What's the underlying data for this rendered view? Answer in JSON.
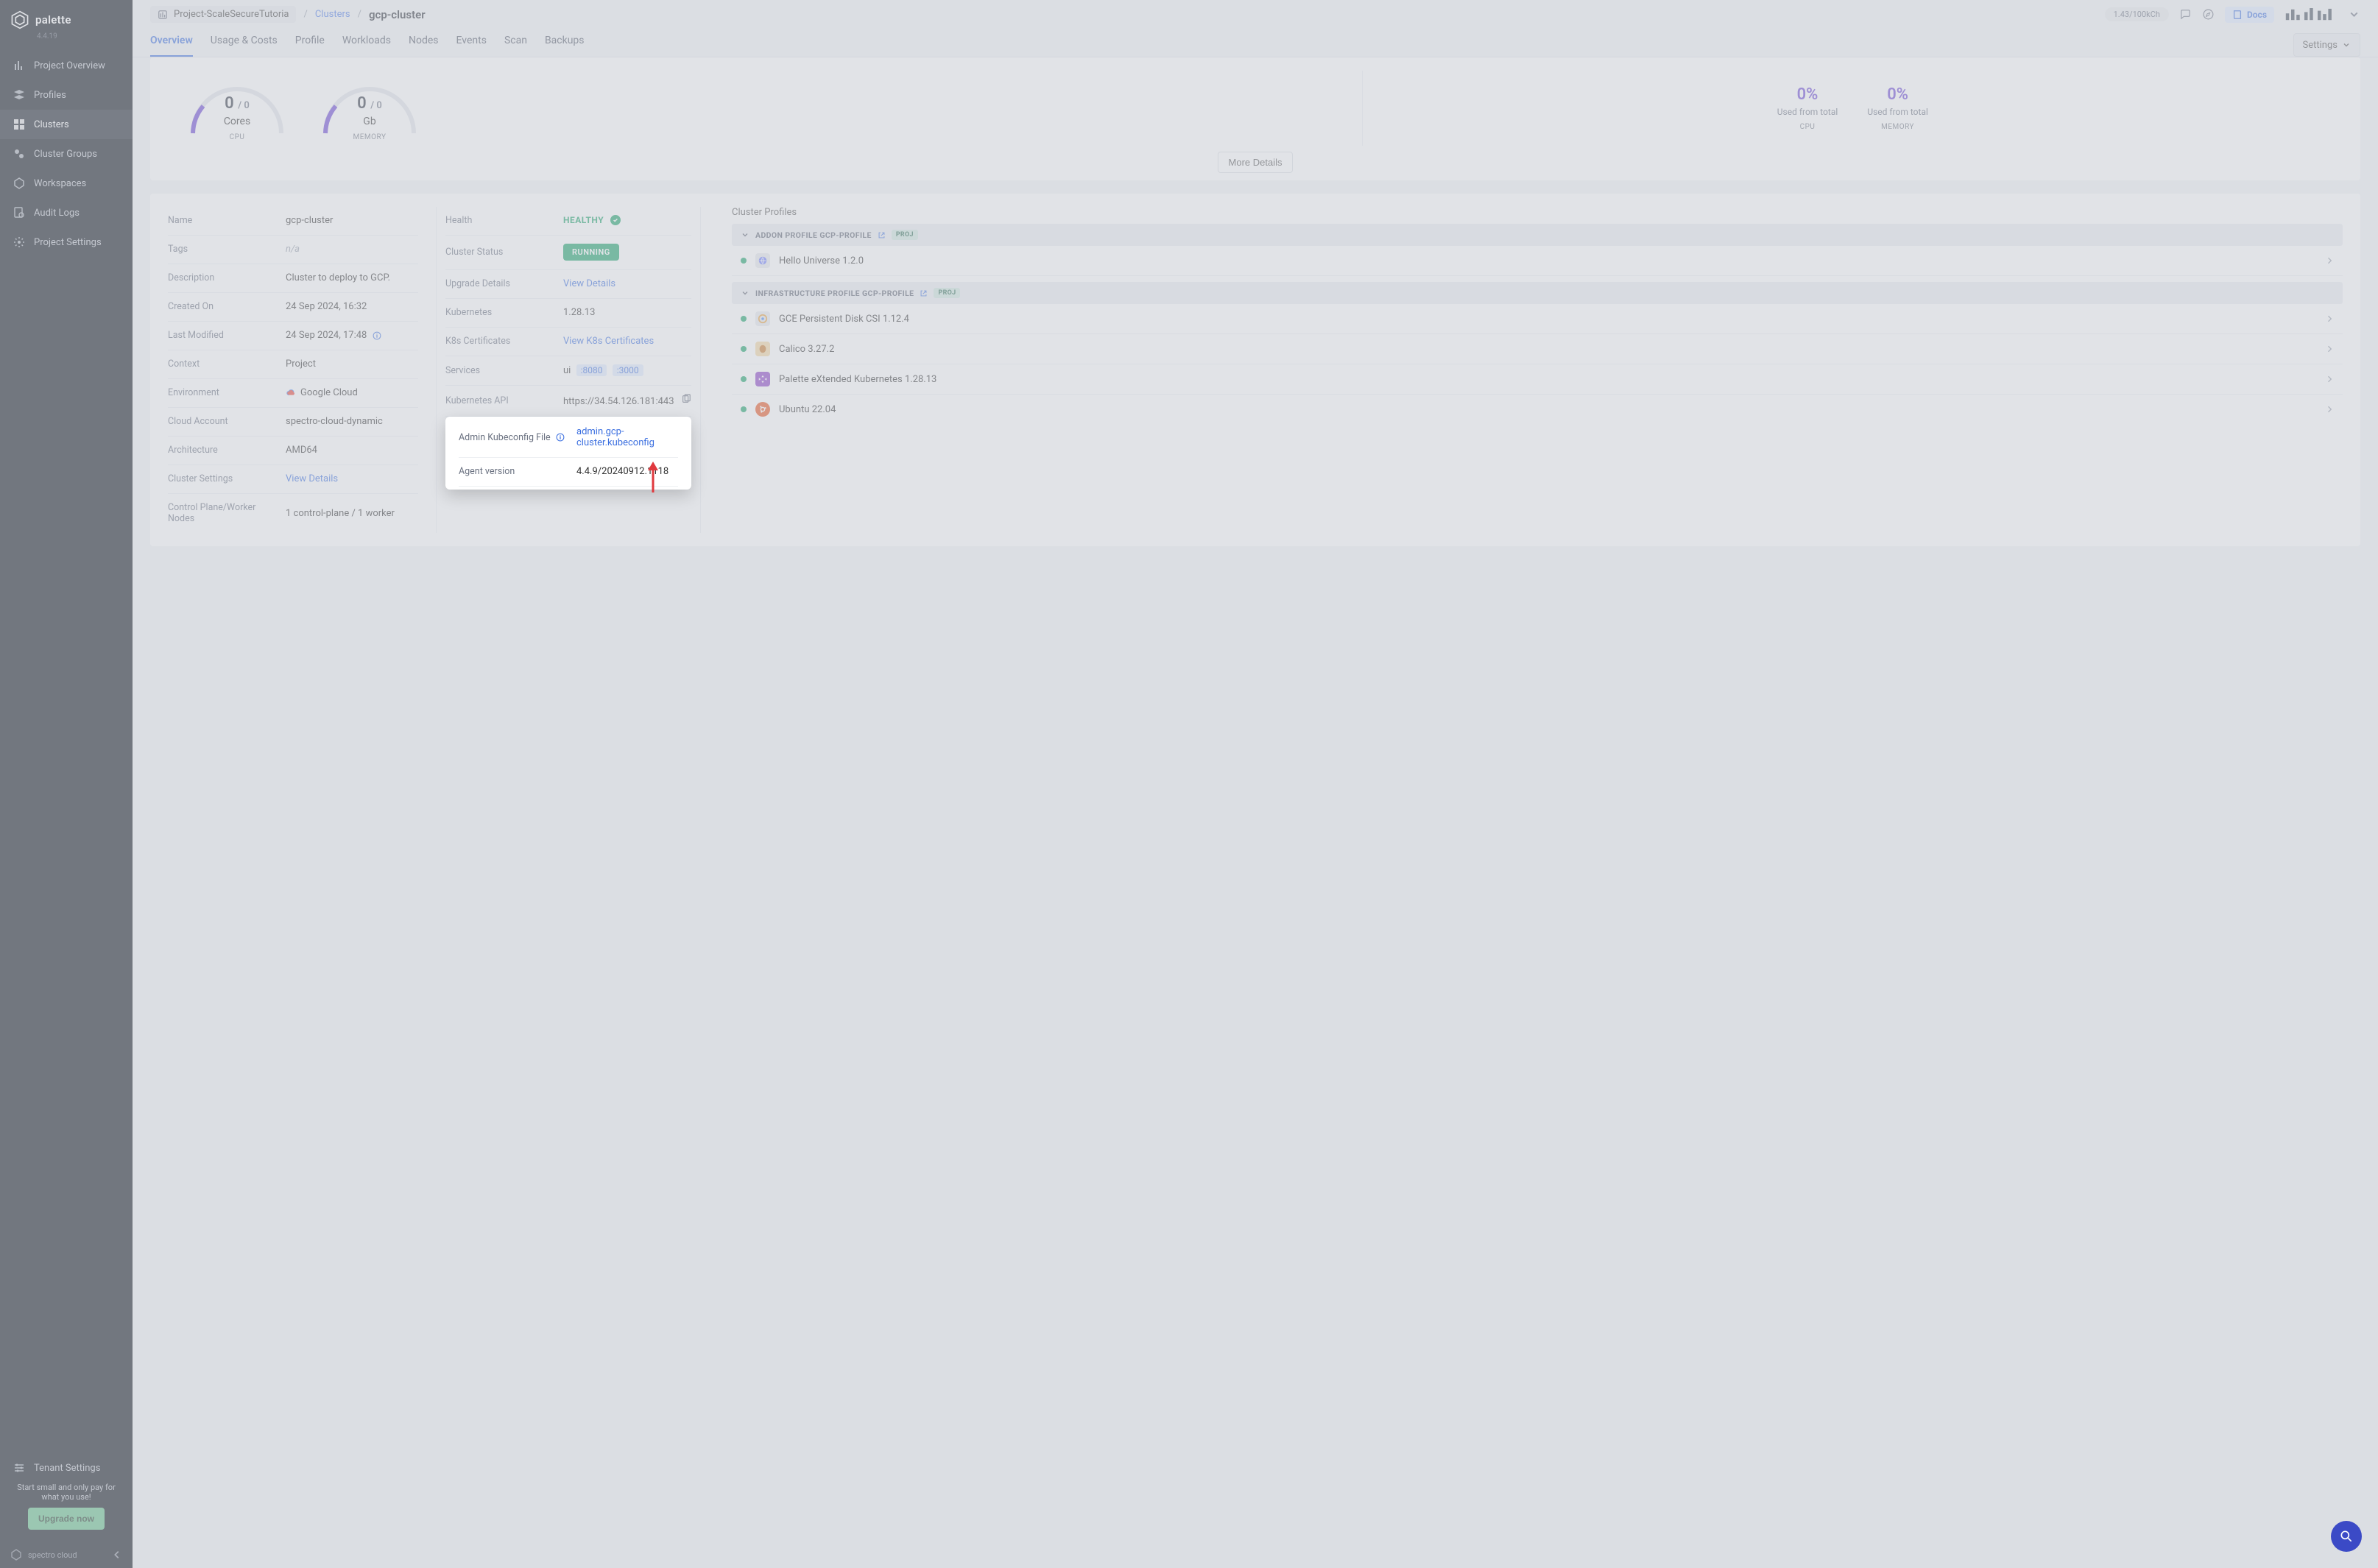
{
  "brand": {
    "name": "palette",
    "version": "4.4.19",
    "footer": "spectro cloud"
  },
  "sidebar": {
    "items": [
      {
        "label": "Project Overview"
      },
      {
        "label": "Profiles"
      },
      {
        "label": "Clusters"
      },
      {
        "label": "Cluster Groups"
      },
      {
        "label": "Workspaces"
      },
      {
        "label": "Audit Logs"
      },
      {
        "label": "Project Settings"
      }
    ],
    "tenant_settings_label": "Tenant Settings",
    "pricing_text": "Start small and only pay for what you use!",
    "upgrade_label": "Upgrade now"
  },
  "topbar": {
    "project": "Project-ScaleSecureTutoria",
    "crumb_parent": "Clusters",
    "crumb_current": "gcp-cluster",
    "usage": "1.43/100kCh",
    "docs_label": "Docs"
  },
  "tabs": {
    "items": [
      "Overview",
      "Usage & Costs",
      "Profile",
      "Workloads",
      "Nodes",
      "Events",
      "Scan",
      "Backups"
    ],
    "active": 0,
    "settings_label": "Settings"
  },
  "metrics": {
    "cpu": {
      "value": "0",
      "total": "/ 0",
      "unit": "Cores",
      "label": "CPU"
    },
    "memory": {
      "value": "0",
      "total": "/ 0",
      "unit": "Gb",
      "label": "MEMORY"
    },
    "totals": {
      "cpu": {
        "pct": "0%",
        "text": "Used from total",
        "label": "CPU"
      },
      "memory": {
        "pct": "0%",
        "text": "Used from total",
        "label": "MEMORY"
      }
    },
    "more_details": "More Details"
  },
  "details": {
    "left": {
      "name": {
        "key": "Name",
        "value": "gcp-cluster"
      },
      "tags": {
        "key": "Tags",
        "value": "n/a"
      },
      "description": {
        "key": "Description",
        "value": "Cluster to deploy to GCP."
      },
      "created_on": {
        "key": "Created On",
        "value": "24 Sep 2024, 16:32"
      },
      "last_modified": {
        "key": "Last Modified",
        "value": "24 Sep 2024, 17:48"
      },
      "context": {
        "key": "Context",
        "value": "Project"
      },
      "environment": {
        "key": "Environment",
        "value": "Google Cloud"
      },
      "cloud_account": {
        "key": "Cloud Account",
        "value": "spectro-cloud-dynamic"
      },
      "architecture": {
        "key": "Architecture",
        "value": "AMD64"
      },
      "cluster_settings": {
        "key": "Cluster Settings",
        "link": "View Details"
      },
      "cp_wn": {
        "key": "Control Plane/Worker Nodes",
        "value": "1 control-plane / 1 worker"
      }
    },
    "mid": {
      "health": {
        "key": "Health",
        "value": "HEALTHY"
      },
      "cluster_status": {
        "key": "Cluster Status",
        "value": "RUNNING"
      },
      "upgrade_details": {
        "key": "Upgrade Details",
        "link": "View Details"
      },
      "kubernetes": {
        "key": "Kubernetes",
        "value": "1.28.13"
      },
      "k8s_certs": {
        "key": "K8s Certificates",
        "link": "View K8s Certificates"
      },
      "services": {
        "key": "Services",
        "name": "ui",
        "port1": ":8080",
        "port2": ":3000"
      },
      "kube_api": {
        "key": "Kubernetes API",
        "value": "https://34.54.126.181:443"
      },
      "admin_kubeconfig": {
        "key": "Admin Kubeconfig File",
        "link": "admin.gcp-cluster.kubeconfig"
      },
      "agent_version": {
        "key": "Agent version",
        "value": "4.4.9/20240912.1118"
      }
    },
    "right": {
      "title": "Cluster Profiles",
      "addon_header": "ADDON PROFILE GCP-PROFILE",
      "infra_header": "INFRASTRUCTURE PROFILE GCP-PROFILE",
      "proj_badge": "PROJ",
      "addon_packs": [
        {
          "label": "Hello Universe 1.2.0"
        }
      ],
      "infra_packs": [
        {
          "label": "GCE Persistent Disk CSI 1.12.4"
        },
        {
          "label": "Calico 3.27.2"
        },
        {
          "label": "Palette eXtended Kubernetes 1.28.13"
        },
        {
          "label": "Ubuntu 22.04"
        }
      ]
    }
  },
  "colors": {
    "accent": "#3b6fe0",
    "purple": "#6a46d6",
    "green": "#1aa268"
  }
}
